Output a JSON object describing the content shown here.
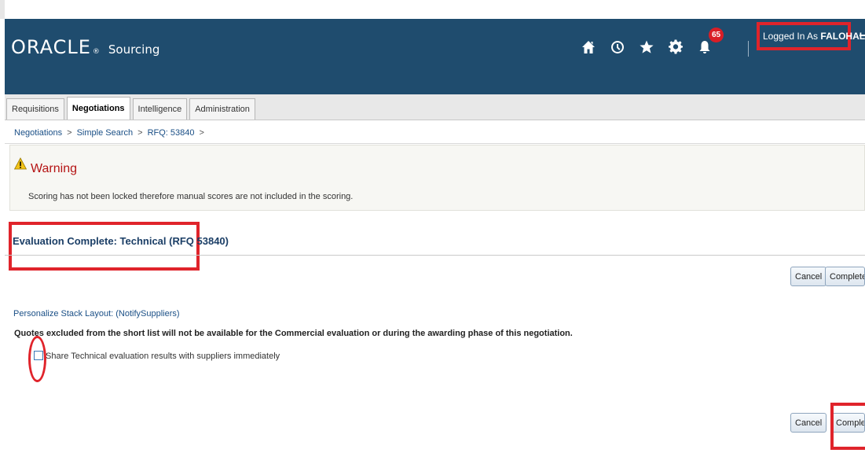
{
  "header": {
    "logo": "ORACLE",
    "logo_mark": "®",
    "product": "Sourcing",
    "notification_count": "65",
    "logged_in_prefix": "Logged In As",
    "username": "FALOHALI",
    "icons": [
      "home-icon",
      "clock-icon",
      "star-icon",
      "gear-icon",
      "bell-icon",
      "logout-icon"
    ]
  },
  "tabs": [
    {
      "label": "Requisitions",
      "active": false
    },
    {
      "label": "Negotiations",
      "active": true
    },
    {
      "label": "Intelligence",
      "active": false
    },
    {
      "label": "Administration",
      "active": false
    }
  ],
  "breadcrumb": {
    "items": [
      "Negotiations",
      "Simple Search",
      "RFQ: 53840"
    ],
    "separator": ">"
  },
  "warning": {
    "title": "Warning",
    "message": "Scoring has not been locked therefore manual scores are not included in the scoring."
  },
  "page": {
    "title": "Evaluation Complete: Technical (RFQ 53840)",
    "personalize_link": "Personalize Stack Layout: (NotifySuppliers)",
    "quotes_notice": "Quotes excluded from the short list will not be available for the Commercial evaluation or during the awarding phase of this negotiation.",
    "share_checkbox_label": "Share Technical evaluation results with suppliers immediately",
    "share_checked": false
  },
  "buttons": {
    "cancel": "Cancel",
    "complete": "Complete"
  },
  "colors": {
    "header_bg": "#1f4c6e",
    "highlight_red": "#e0242b",
    "warning_title": "#b51414",
    "link_blue": "#1a4f86"
  }
}
